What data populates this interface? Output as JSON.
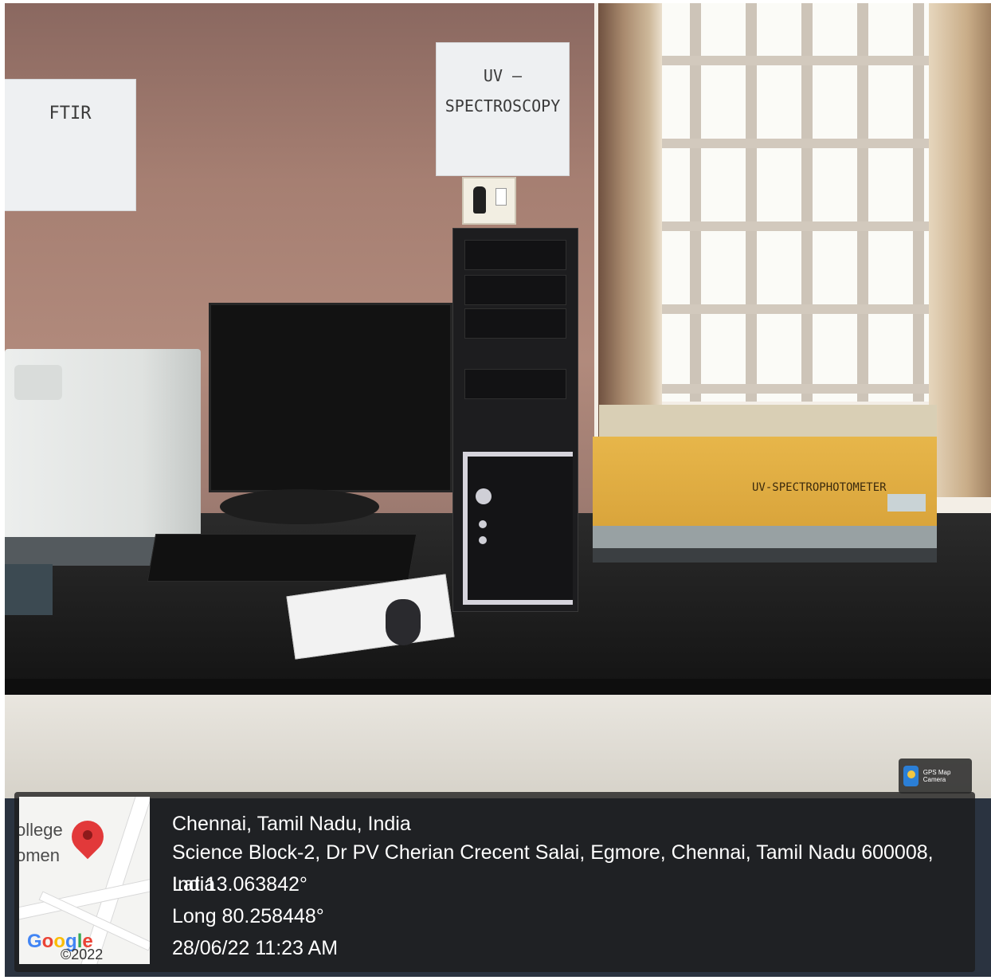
{
  "signs": {
    "ftir": "FTIR",
    "uv_line1": "UV –",
    "uv_line2": "SPECTROSCOPY"
  },
  "instrument_label": "UV-SPECTROPHOTOMETER",
  "overlay": {
    "map_place": "ollege\nomen",
    "google_logo": "Google",
    "map_copyright": "©2022 Google",
    "city": "Chennai, Tamil Nadu, India",
    "address": "Science Block-2, Dr PV Cherian Crecent Salai, Egmore, Chennai, Tamil Nadu 600008, India",
    "lat": "Lat 13.063842°",
    "long": "Long 80.258448°",
    "datetime": "28/06/22 11:23 AM",
    "camera_app": "GPS Map Camera"
  },
  "icons": [
    "map-pin-icon",
    "gps-map-camera-icon"
  ],
  "colors": {
    "instrument_yellow": "#e0ad44",
    "overlay_bg": "#1c1c1c",
    "pin": "#e2393a"
  }
}
